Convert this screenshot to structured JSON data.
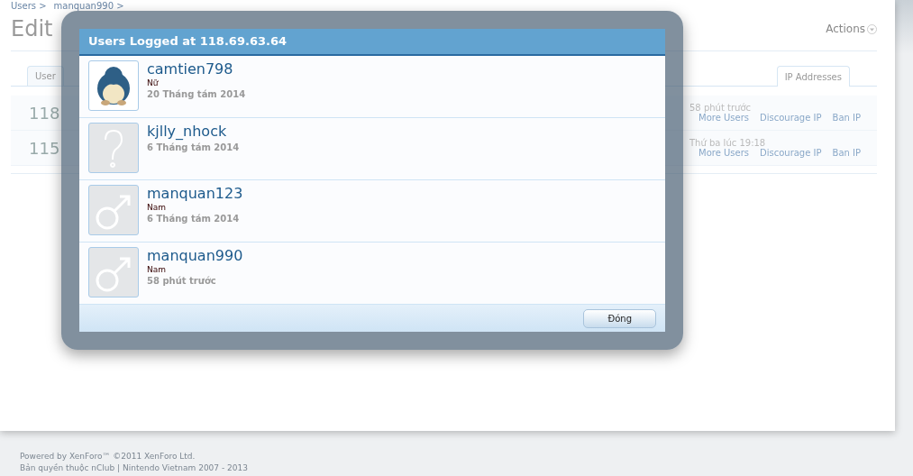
{
  "breadcrumbs": [
    "Users >",
    "manquan990 >"
  ],
  "page_title": "Edit",
  "actions": {
    "label": "Actions"
  },
  "tabs": [
    {
      "label": "User",
      "selected": false
    },
    {
      "label": "IP Addresses",
      "selected": true
    }
  ],
  "ip_rows": [
    {
      "ip": "118",
      "time": "58 phút trước",
      "links": [
        "More Users",
        "Discourage IP",
        "Ban IP"
      ]
    },
    {
      "ip": "115",
      "time": "Thứ ba lúc 19:18",
      "links": [
        "More Users",
        "Discourage IP",
        "Ban IP"
      ]
    }
  ],
  "dialog": {
    "title": "Users Logged at 118.69.63.64",
    "close_button": "Đóng",
    "users": [
      {
        "name": "camtien798",
        "gender": "Nữ",
        "date": "20 Tháng tám 2014",
        "kind": "picture"
      },
      {
        "name": "kjlly_nhock",
        "date": "6 Tháng tám 2014",
        "kind": "unknown"
      },
      {
        "name": "manquan123",
        "gender": "Nam",
        "date": "6 Tháng tám 2014",
        "kind": "male"
      },
      {
        "name": "manquan990",
        "gender": "Nam",
        "date": "58 phút trước",
        "kind": "male"
      }
    ]
  },
  "footer": [
    "Powered by XenForo™ ©2011 XenForo Ltd.",
    "Bản quyền thuộc nClub | Nintendo Vietnam 2007 - 2013"
  ]
}
